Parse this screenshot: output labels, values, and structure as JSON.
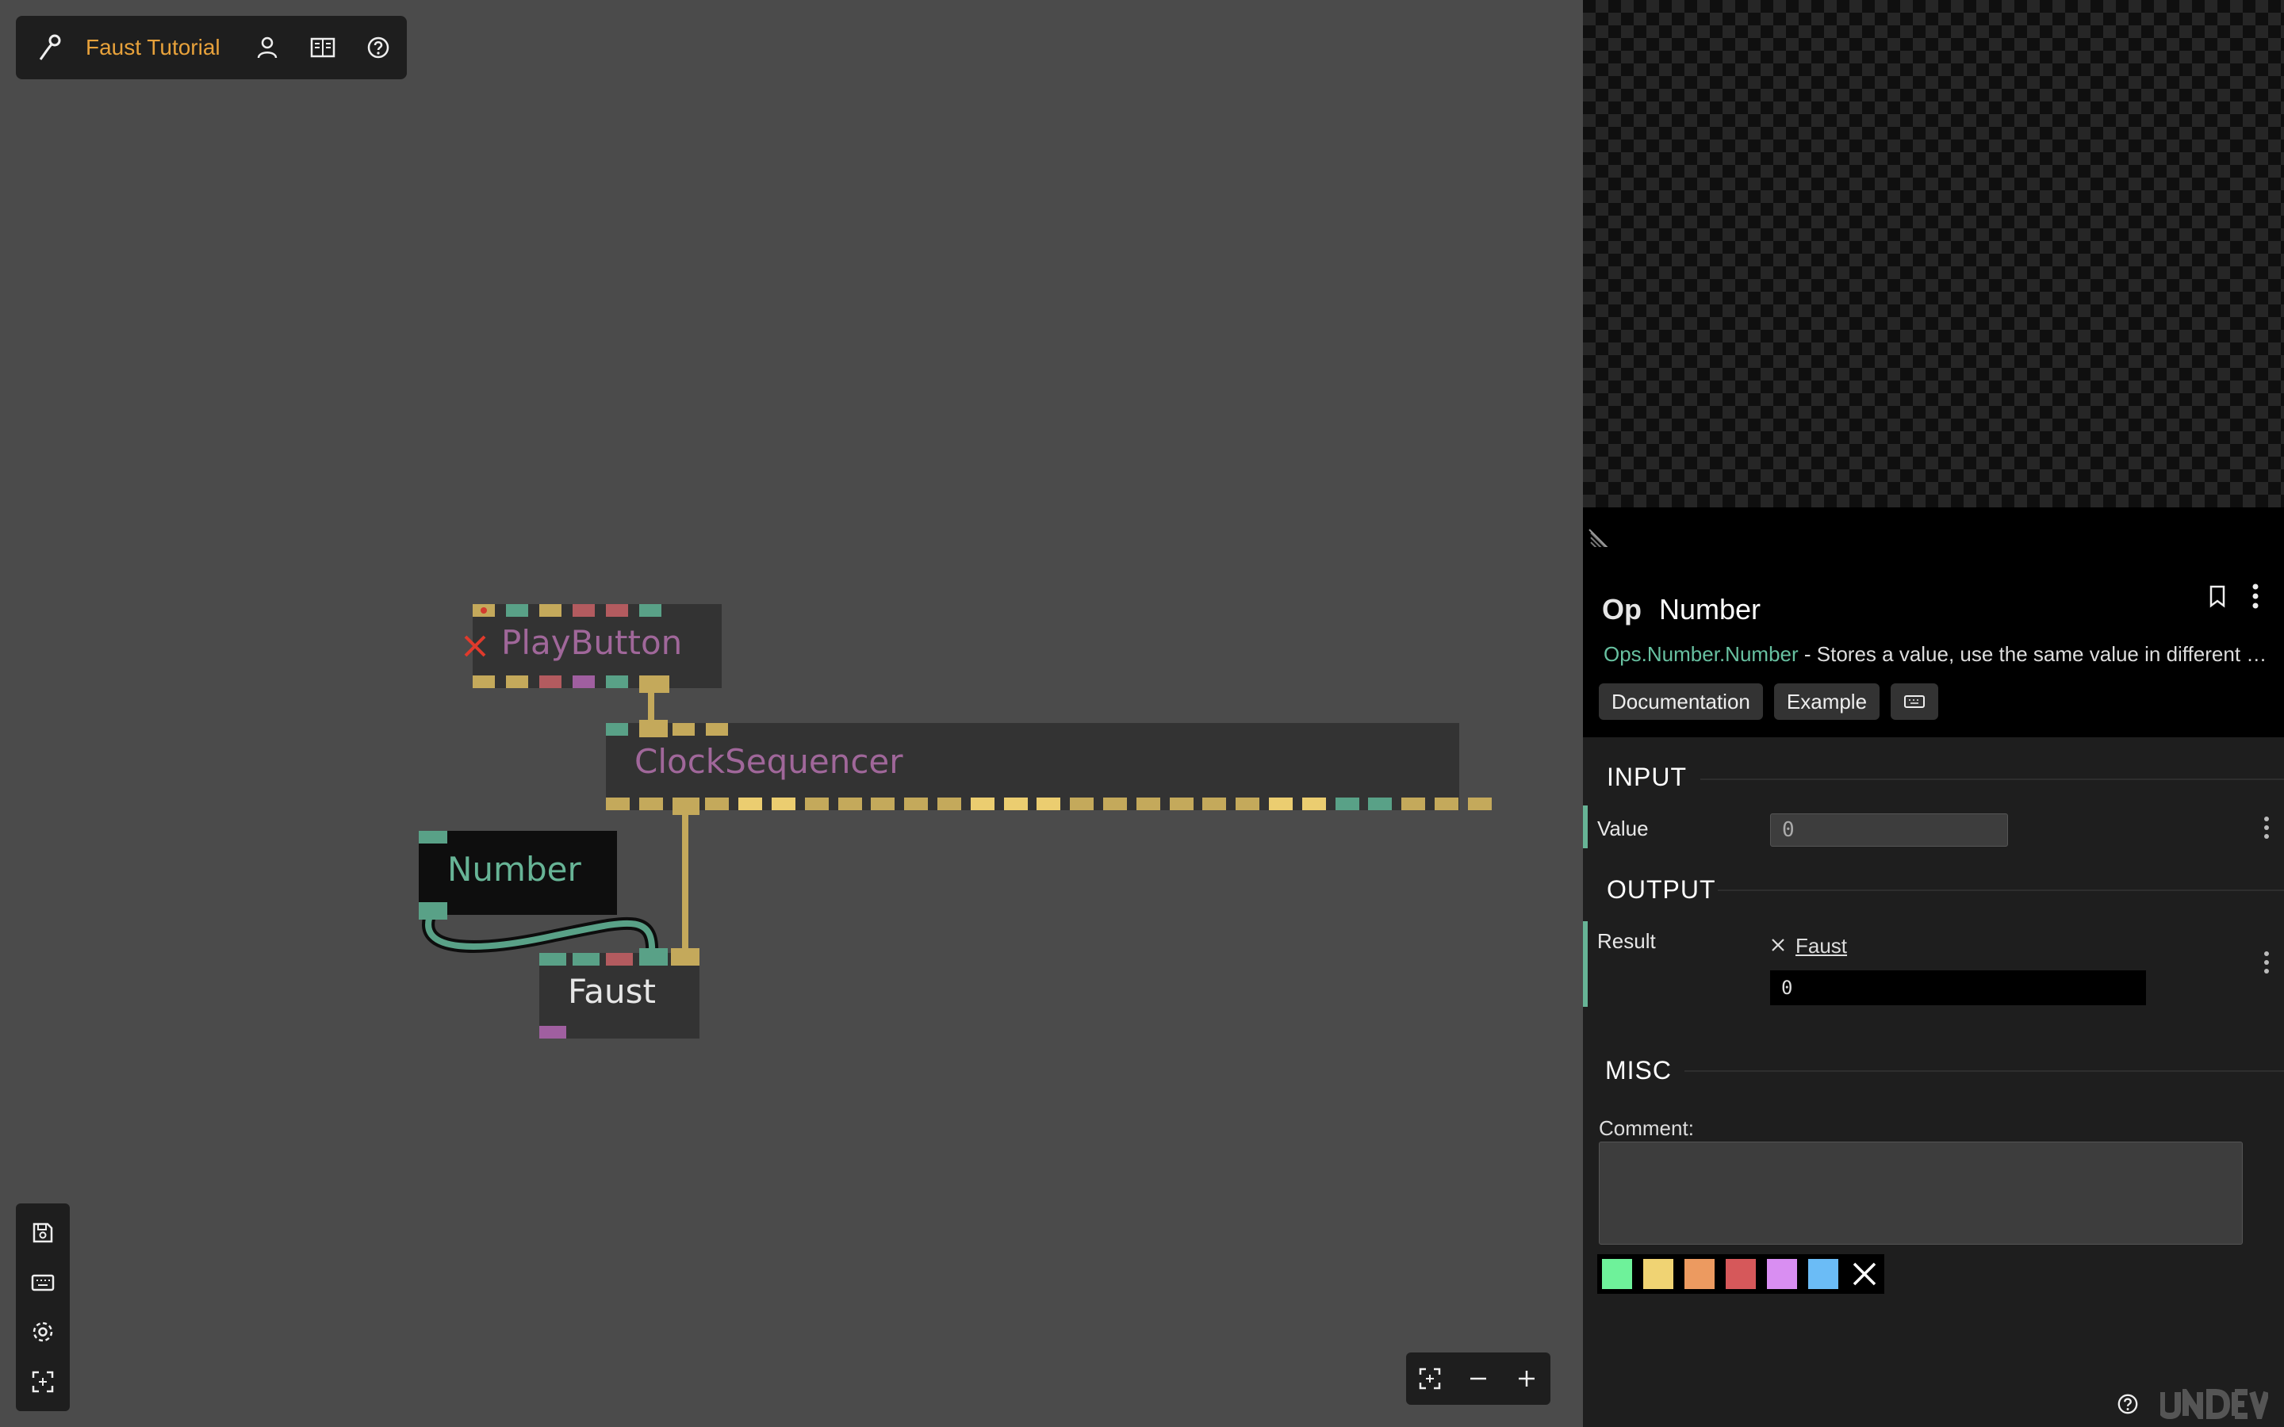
{
  "app": {
    "project_title": "Faust Tutorial",
    "icons": {
      "logo": "cables-logo-icon",
      "user": "user-icon",
      "docs": "book-icon",
      "help": "help-circle-icon"
    }
  },
  "canvas": {
    "ops": {
      "playbutton": {
        "label": "PlayButton",
        "status": "error-x-icon"
      },
      "clocksequencer": {
        "label": "ClockSequencer"
      },
      "number": {
        "label": "Number",
        "selected": true
      },
      "faust": {
        "label": "Faust"
      }
    }
  },
  "left_tools": {
    "items": [
      "save-icon",
      "keyboard-icon",
      "settings-icon",
      "focus-icon"
    ]
  },
  "zoom_tools": {
    "items": [
      "zoom-fit-icon",
      "zoom-out-icon",
      "zoom-in-icon"
    ]
  },
  "panel": {
    "op_kind": "Op",
    "op_name": "Number",
    "namespace": "Ops.Number.Number",
    "description": " - Stores a value, use the same value in different places in your patch",
    "buttons": {
      "documentation": "Documentation",
      "example": "Example"
    },
    "input": {
      "title": "INPUT",
      "params": [
        {
          "label": "Value",
          "value": "0"
        }
      ]
    },
    "output": {
      "title": "OUTPUT",
      "params": [
        {
          "label": "Result",
          "link": "Faust",
          "value": "0"
        }
      ]
    },
    "misc": {
      "title": "MISC",
      "comment_label": "Comment:",
      "comment_value": ""
    },
    "colors": [
      "#6ef29a",
      "#f0d373",
      "#ec9a60",
      "#d6585a",
      "#d98ef2",
      "#6bbcf6"
    ]
  },
  "port_colors": {
    "trigger": "#c4a95b",
    "number": "#59a187",
    "string": "#b35b5f",
    "object": "#a05fa0",
    "array": "#ebcd70"
  }
}
